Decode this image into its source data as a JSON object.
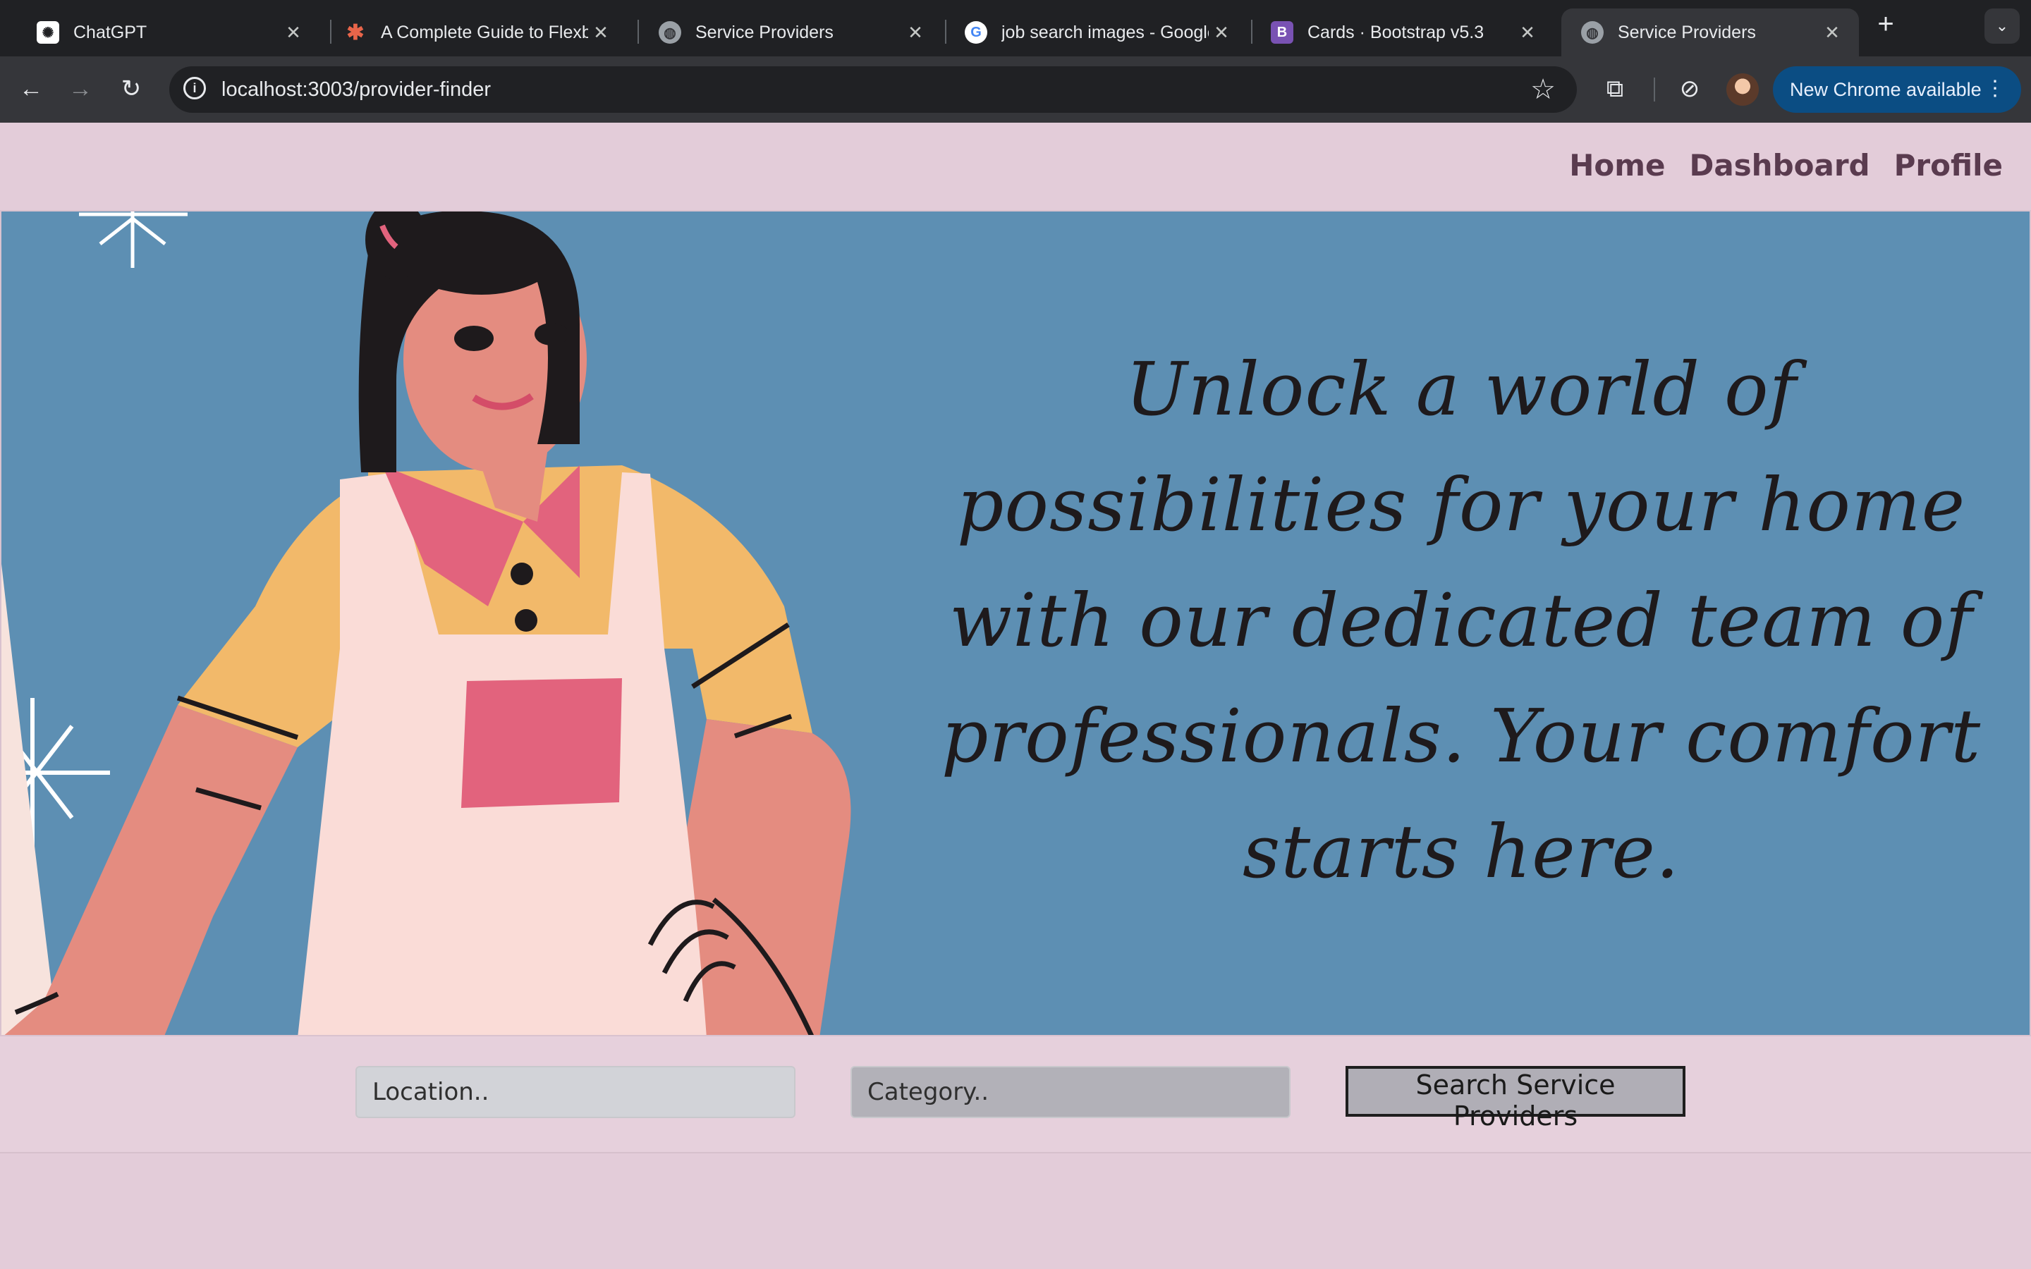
{
  "browser": {
    "tabs": [
      {
        "title": "ChatGPT",
        "icon": "chatgpt-icon",
        "active": false
      },
      {
        "title": "A Complete Guide to Flexbox",
        "icon": "css-tricks-icon",
        "active": false
      },
      {
        "title": "Service Providers",
        "icon": "globe-icon",
        "active": false
      },
      {
        "title": "job search images - Google Search",
        "icon": "google-icon",
        "active": false
      },
      {
        "title": "Cards · Bootstrap v5.3",
        "icon": "bootstrap-icon",
        "active": false
      },
      {
        "title": "Service Providers",
        "icon": "globe-icon",
        "active": true
      }
    ],
    "url": "localhost:3003/provider-finder",
    "update_label": "New Chrome available"
  },
  "nav": {
    "home": "Home",
    "dashboard": "Dashboard",
    "profile": "Profile"
  },
  "hero": {
    "tagline": "Unlock a world of possibilities for your home with our dedicated team of professionals. Your comfort starts here.",
    "background_color": "#5d8fb3"
  },
  "search": {
    "location_placeholder": "Location..",
    "category_placeholder": "Category..",
    "button_label": "Search Service Providers"
  },
  "colors": {
    "page_background": "#e3ccd9",
    "nav_text": "#5a3b4f"
  }
}
